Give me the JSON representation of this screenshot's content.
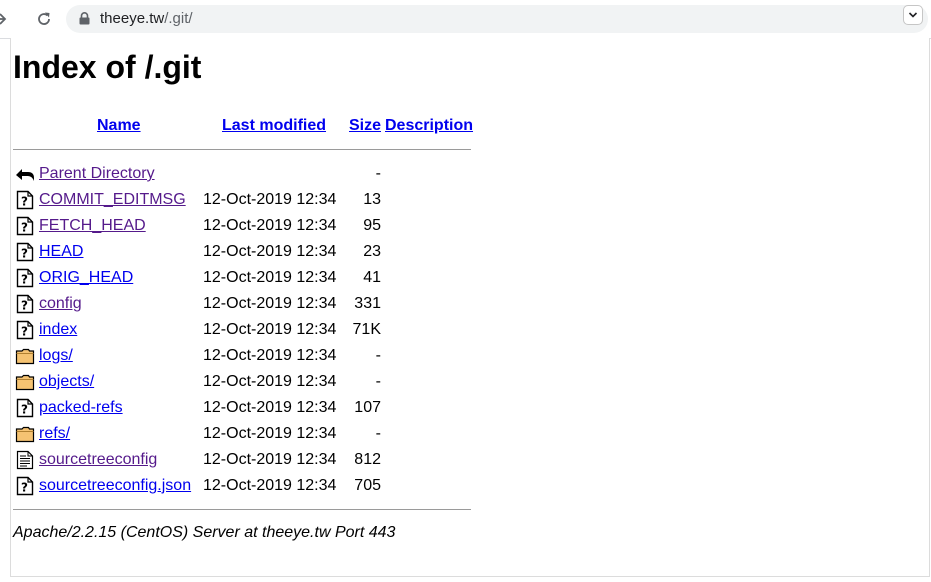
{
  "browser": {
    "url_host": "theeye.tw",
    "url_path": "/.git/"
  },
  "page": {
    "title": "Index of /.git",
    "columns": {
      "name": "Name",
      "last_modified": "Last modified",
      "size": "Size",
      "description": "Description"
    },
    "parent": {
      "name": "Parent Directory",
      "size": "-"
    },
    "entries": [
      {
        "name": "COMMIT_EDITMSG",
        "modified": "12-Oct-2019 12:34",
        "size": "13",
        "icon": "unknown-file-icon",
        "visited": true
      },
      {
        "name": "FETCH_HEAD",
        "modified": "12-Oct-2019 12:34",
        "size": "95",
        "icon": "unknown-file-icon",
        "visited": true
      },
      {
        "name": "HEAD",
        "modified": "12-Oct-2019 12:34",
        "size": "23",
        "icon": "unknown-file-icon",
        "visited": false
      },
      {
        "name": "ORIG_HEAD",
        "modified": "12-Oct-2019 12:34",
        "size": "41",
        "icon": "unknown-file-icon",
        "visited": false
      },
      {
        "name": "config",
        "modified": "12-Oct-2019 12:34",
        "size": "331",
        "icon": "unknown-file-icon",
        "visited": true
      },
      {
        "name": "index",
        "modified": "12-Oct-2019 12:34",
        "size": "71K",
        "icon": "unknown-file-icon",
        "visited": false
      },
      {
        "name": "logs/",
        "modified": "12-Oct-2019 12:34",
        "size": "-",
        "icon": "folder-icon",
        "visited": false
      },
      {
        "name": "objects/",
        "modified": "12-Oct-2019 12:34",
        "size": "-",
        "icon": "folder-icon",
        "visited": false
      },
      {
        "name": "packed-refs",
        "modified": "12-Oct-2019 12:34",
        "size": "107",
        "icon": "unknown-file-icon",
        "visited": false
      },
      {
        "name": "refs/",
        "modified": "12-Oct-2019 12:34",
        "size": "-",
        "icon": "folder-icon",
        "visited": false
      },
      {
        "name": "sourcetreeconfig",
        "modified": "12-Oct-2019 12:34",
        "size": "812",
        "icon": "text-file-icon",
        "visited": true
      },
      {
        "name": "sourcetreeconfig.json",
        "modified": "12-Oct-2019 12:34",
        "size": "705",
        "icon": "unknown-file-icon",
        "visited": false
      }
    ],
    "footer": "Apache/2.2.15 (CentOS) Server at theeye.tw Port 443"
  },
  "colors": {
    "link": "#0000ee",
    "visited": "#551a8b",
    "folder": "#f5c372"
  }
}
